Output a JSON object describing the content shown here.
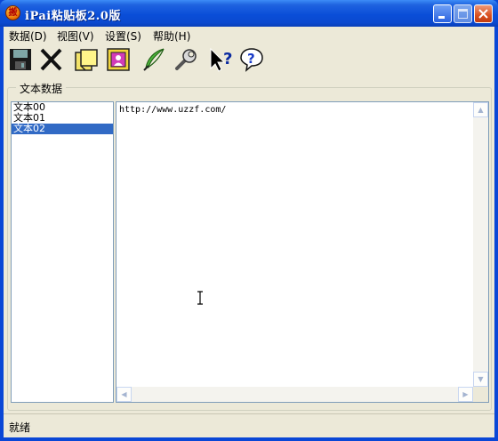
{
  "window": {
    "title": "iPai粘贴板2.0版",
    "icon_char": "搬"
  },
  "menu": [
    {
      "label": "数据(D)"
    },
    {
      "label": "视图(V)"
    },
    {
      "label": "设置(S)"
    },
    {
      "label": "帮助(H)"
    }
  ],
  "toolbar": [
    {
      "name": "save-icon"
    },
    {
      "name": "delete-icon"
    },
    {
      "name": "notes-icon"
    },
    {
      "name": "stamp-icon"
    },
    {
      "name": "feather-icon"
    },
    {
      "name": "wrench-icon"
    },
    {
      "name": "context-help-icon"
    },
    {
      "name": "help-icon"
    }
  ],
  "group": {
    "label": "文本数据"
  },
  "list": {
    "items": [
      "文本00",
      "文本01",
      "文本02"
    ],
    "selected_index": 2
  },
  "editor": {
    "content": "http://www.uzzf.com/"
  },
  "status": {
    "text": "就绪"
  },
  "colors": {
    "selection": "#316ac5",
    "face": "#ece9d8",
    "titlebar": "#0a4ed8"
  }
}
